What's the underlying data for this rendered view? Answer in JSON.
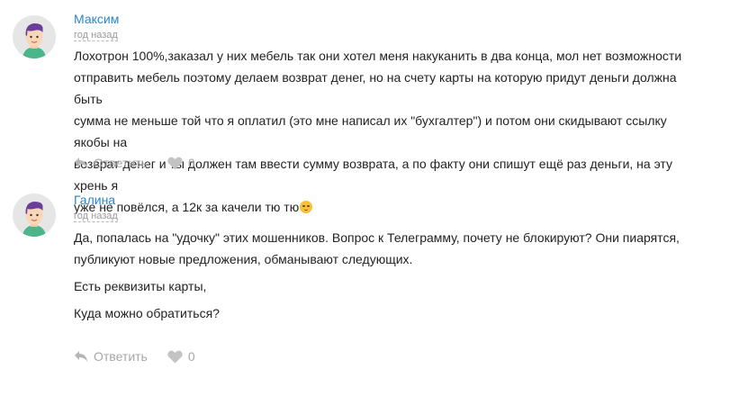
{
  "comments": [
    {
      "author": "Максим",
      "time": "год назад",
      "text_lines": [
        "Лохотрон 100%,заказал у них мебель так они хотел меня накуканить в два конца, мол нет возможности",
        "отправить мебель поэтому делаем возврат денег, но на счету карты на которую придут деньги должна быть",
        "сумма не меньше той что я оплатил (это мне написал их \"бухгалтер\") и потом они скидывают ссылку якобы на",
        "возврат денег и ты должен там ввести сумму возврата, а по факту они спишут ещё раз деньги, на эту хрень я",
        "уже не повёлся, а 12к за качели тю тю"
      ],
      "reply_label": "Ответить",
      "likes": "0"
    },
    {
      "author": "Галина",
      "time": "год назад",
      "text_lines": [
        "Да, попалась на \"удочку\" этих мошенников. Вопрос к Телеграмму, почету не блокируют? Они пиарятся,",
        "публикуют новые предложения, обманывают следующих.",
        "Есть реквизиты карты,",
        "Куда можно обратиться?"
      ],
      "reply_label": "Ответить",
      "likes": "0"
    }
  ],
  "icons": {
    "avatar": "avatar-icon",
    "reply": "reply-arrow-icon",
    "like": "heart-icon",
    "emoji": "sad-face-emoji-icon"
  },
  "colors": {
    "author_link": "#2b87c6",
    "muted": "#a6a6a6",
    "avatar_bg": "#e6e6e6",
    "avatar_hair": "#6a3e9a"
  }
}
